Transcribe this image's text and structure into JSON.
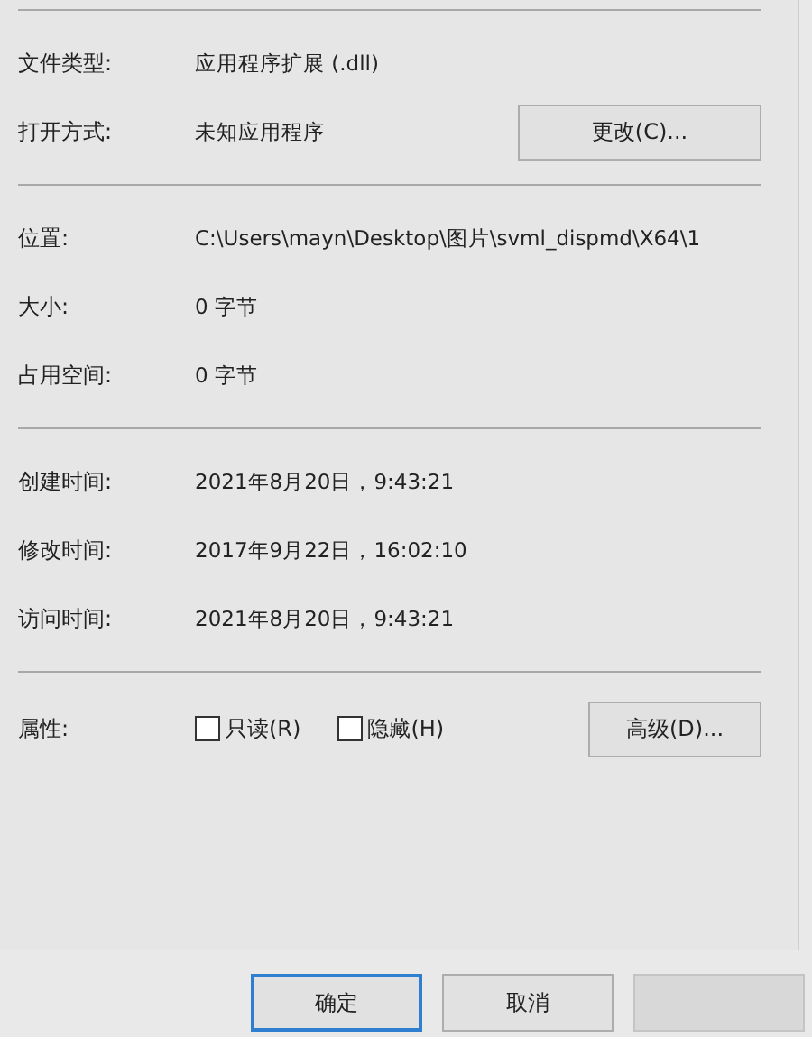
{
  "sections": [
    {
      "rows": [
        {
          "label": "文件类型:",
          "value": "应用程序扩展 (.dll)"
        },
        {
          "label": "打开方式:",
          "value": "未知应用程序",
          "button": "更改(C)..."
        }
      ]
    },
    {
      "rows": [
        {
          "label": "位置:",
          "value": "C:\\Users\\mayn\\Desktop\\图片\\svml_dispmd\\X64\\1"
        },
        {
          "label": "大小:",
          "value": "0 字节"
        },
        {
          "label": "占用空间:",
          "value": "0 字节"
        }
      ]
    },
    {
      "rows": [
        {
          "label": "创建时间:",
          "value": "2021年8月20日，9:43:21"
        },
        {
          "label": "修改时间:",
          "value": "2017年9月22日，16:02:10"
        },
        {
          "label": "访问时间:",
          "value": "2021年8月20日，9:43:21"
        }
      ]
    }
  ],
  "attributes": {
    "label": "属性:",
    "checkboxes": [
      {
        "label": "只读(R)",
        "checked": false
      },
      {
        "label": "隐藏(H)",
        "checked": false
      }
    ],
    "button": "高级(D)..."
  },
  "footer_buttons": [
    {
      "label": "确定",
      "default": true,
      "disabled": false
    },
    {
      "label": "取消",
      "default": false,
      "disabled": false
    },
    {
      "default": false,
      "disabled": true
    }
  ]
}
